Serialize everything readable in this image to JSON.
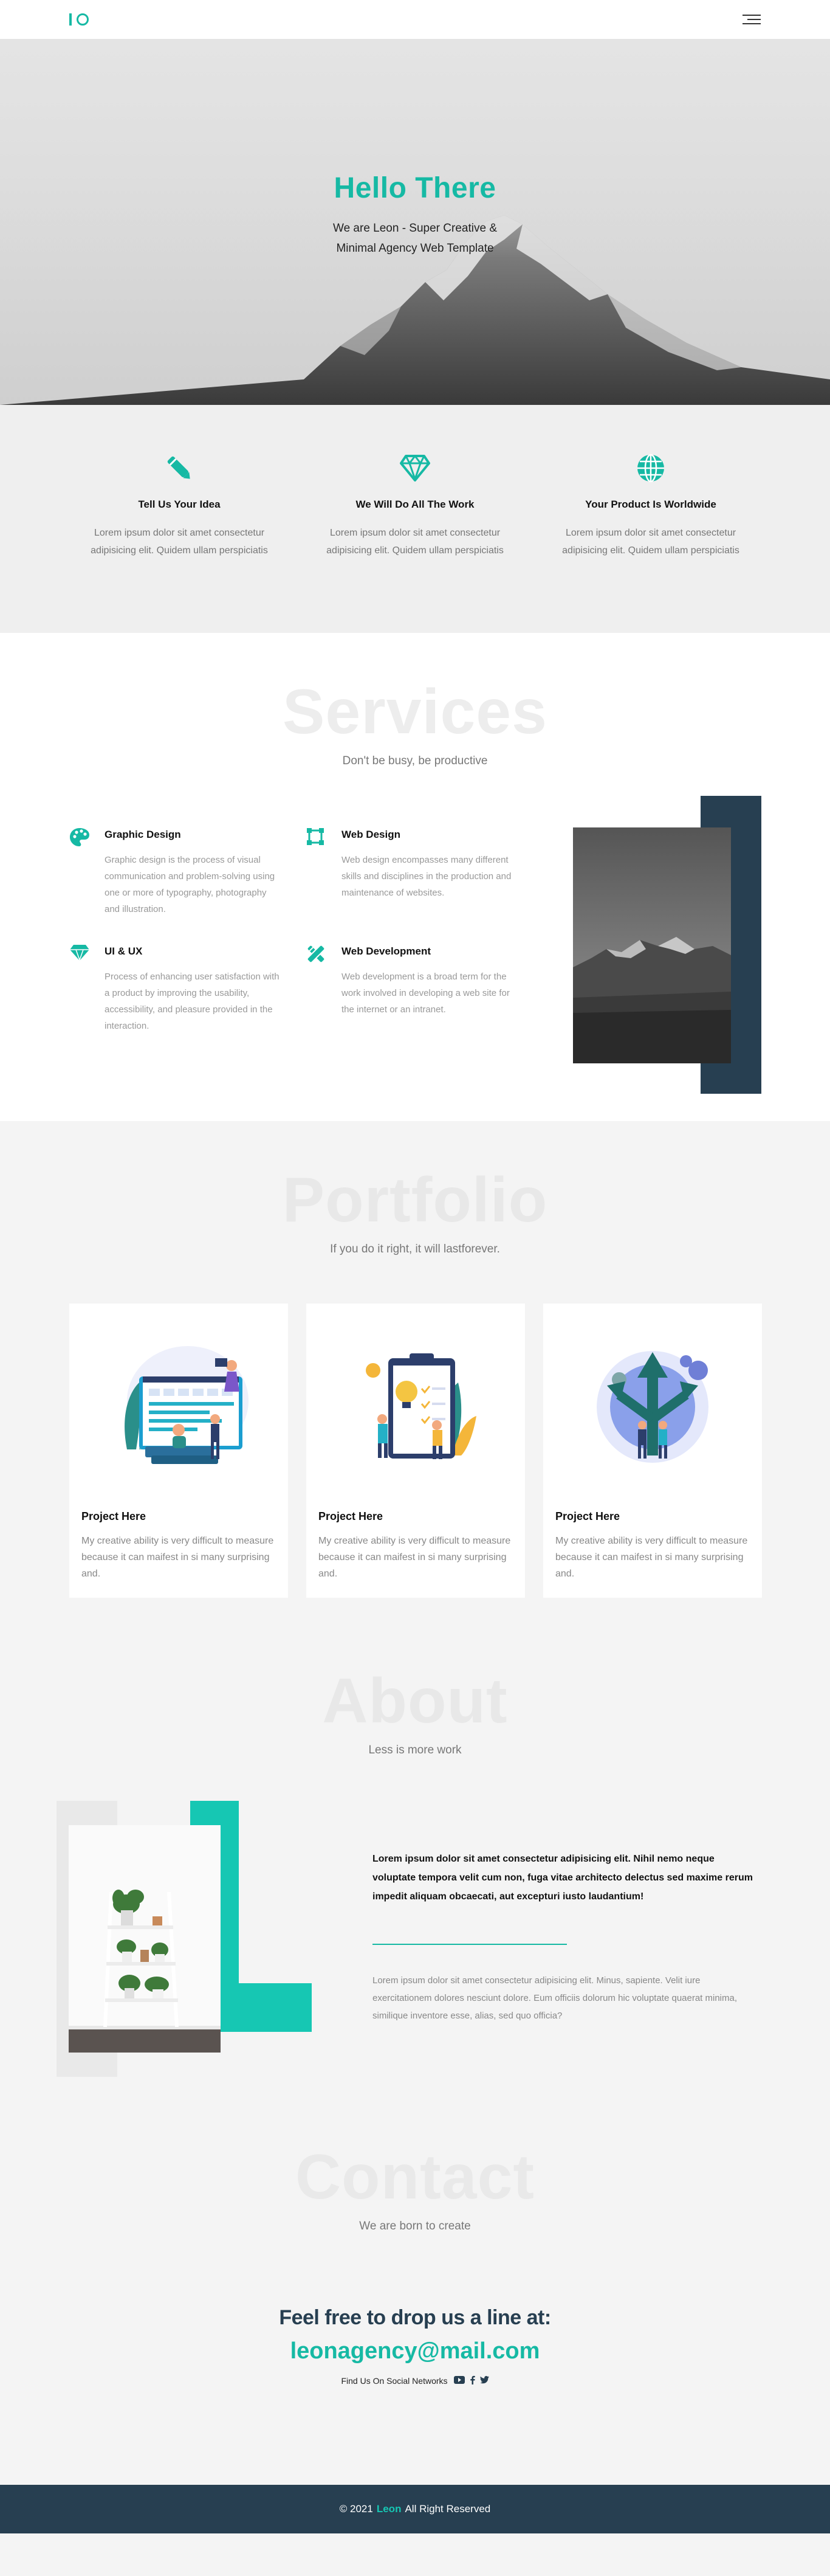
{
  "hero": {
    "title": "Hello There",
    "subtitle": "We are Leon - Super Creative & Minimal Agency Web Template"
  },
  "features": [
    {
      "icon": "pencil-icon",
      "title": "Tell Us Your Idea",
      "text": "Lorem ipsum dolor sit amet consectetur adipisicing elit. Quidem ullam perspiciatis"
    },
    {
      "icon": "diamond-icon",
      "title": "We Will Do All The Work",
      "text": "Lorem ipsum dolor sit amet consectetur adipisicing elit. Quidem ullam perspiciatis"
    },
    {
      "icon": "globe-icon",
      "title": "Your Product Is Worldwide",
      "text": "Lorem ipsum dolor sit amet consectetur adipisicing elit. Quidem ullam perspiciatis"
    }
  ],
  "services": {
    "heading": "Services",
    "subheading": "Don't be busy, be productive",
    "items": [
      {
        "icon": "palette-icon",
        "title": "Graphic Design",
        "text": "Graphic design is the process of visual communication and problem-solving using one or more of typography, photography and illustration."
      },
      {
        "icon": "vector-square-icon",
        "title": "Web Design",
        "text": "Web design encompasses many different skills and disciplines in the production and maintenance of websites."
      },
      {
        "icon": "gem-icon",
        "title": "UI & UX",
        "text": "Process of enhancing user satisfaction with a product by improving the usability, accessibility, and pleasure provided in the interaction."
      },
      {
        "icon": "tools-icon",
        "title": "Web Development",
        "text": "Web development is a broad term for the work involved in developing a web site for the internet or an intranet."
      }
    ]
  },
  "portfolio": {
    "heading": "Portfolio",
    "subheading": "If you do it right, it will lastforever.",
    "cards": [
      {
        "title": "Project Here",
        "text": "My creative ability is very difficult to measure because it can maifest in si many surprising and."
      },
      {
        "title": "Project Here",
        "text": "My creative ability is very difficult to measure because it can maifest in si many surprising and."
      },
      {
        "title": "Project Here",
        "text": "My creative ability is very difficult to measure because it can maifest in si many surprising and."
      }
    ]
  },
  "about": {
    "heading": "About",
    "subheading": "Less is more work",
    "bold_text": "Lorem ipsum dolor sit amet consectetur adipisicing elit. Nihil nemo neque voluptate tempora velit cum non, fuga vitae architecto delectus sed maxime rerum impedit aliquam obcaecati, aut excepturi iusto laudantium!",
    "light_text": "Lorem ipsum dolor sit amet consectetur adipisicing elit. Minus, sapiente. Velit iure exercitationem dolores nesciunt dolore. Eum officiis dolorum hic voluptate quaerat minima, similique inventore esse, alias, sed quo officia?"
  },
  "contact": {
    "heading": "Contact",
    "subheading": "We are born to create",
    "line": "Feel free to drop us a line at:",
    "email": "leonagency@mail.com",
    "social_label": "Find Us On Social Networks"
  },
  "footer": {
    "prefix": "© 2021",
    "brand": "Leon",
    "suffix": "All Right Reserved"
  },
  "colors": {
    "accent": "#16b9a4",
    "dark": "#273f51"
  }
}
